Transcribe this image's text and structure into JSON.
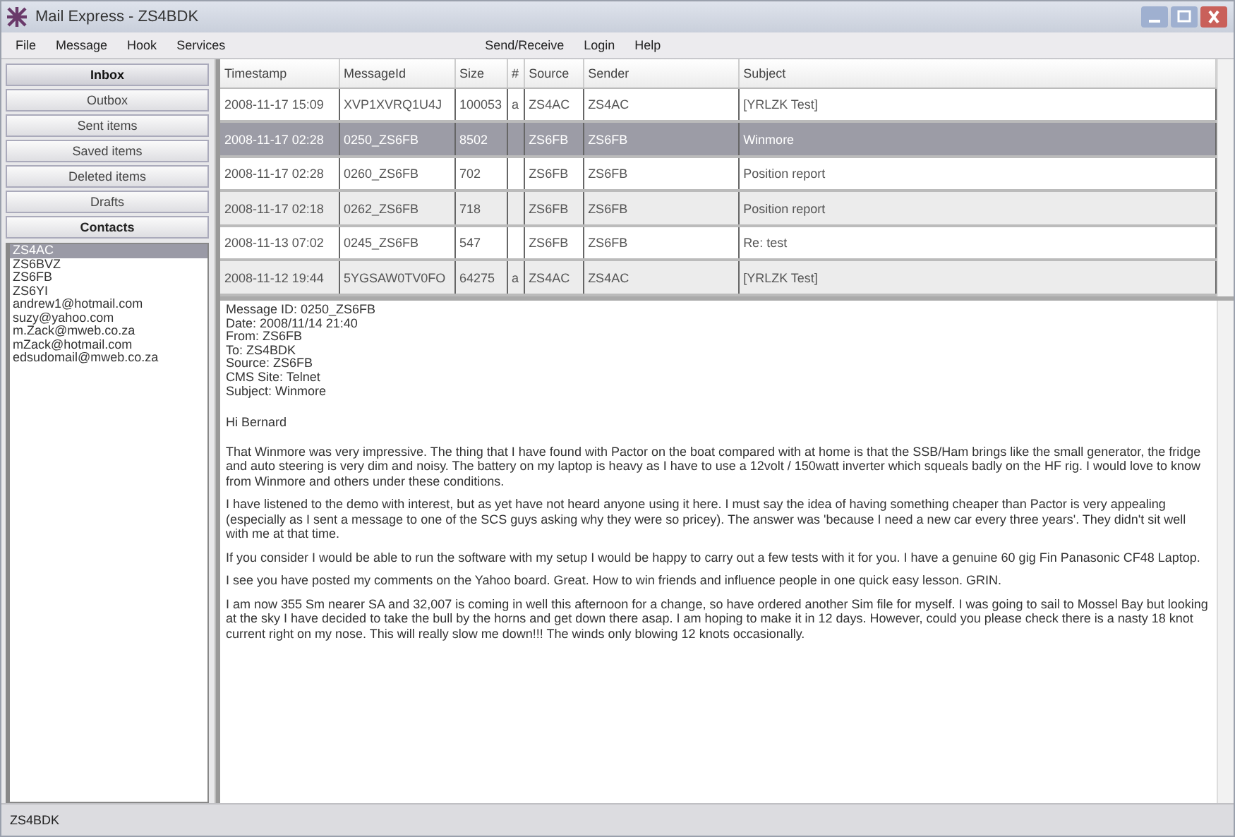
{
  "window": {
    "title": "Mail Express - ZS4BDK"
  },
  "menu": [
    "File",
    "Message",
    "Hook",
    "Services",
    "Send/Receive",
    "Login",
    "Help"
  ],
  "folders": [
    {
      "label": "Inbox",
      "selected": true
    },
    {
      "label": "Outbox",
      "selected": false
    },
    {
      "label": "Sent items",
      "selected": false
    },
    {
      "label": "Saved items",
      "selected": false
    },
    {
      "label": "Deleted items",
      "selected": false
    },
    {
      "label": "Drafts",
      "selected": false
    }
  ],
  "contacts": {
    "label": "Contacts",
    "items": [
      {
        "name": "ZS4AC",
        "selected": true
      },
      {
        "name": "ZS6BVZ",
        "selected": false
      },
      {
        "name": "ZS6FB",
        "selected": false
      },
      {
        "name": "ZS6YI",
        "selected": false
      },
      {
        "name": "andrew1@hotmail.com",
        "selected": false
      },
      {
        "name": "suzy@yahoo.com",
        "selected": false
      },
      {
        "name": "m.Zack@mweb.co.za",
        "selected": false
      },
      {
        "name": "mZack@hotmail.com",
        "selected": false
      },
      {
        "name": "edsudomail@mweb.co.za",
        "selected": false
      }
    ]
  },
  "table": {
    "columns": [
      "Timestamp",
      "MessageId",
      "Size",
      "#",
      "Source",
      "Sender",
      "Subject"
    ],
    "rows": [
      {
        "cells": [
          "2008-11-17 15:09",
          "XVP1XVRQ1U4J",
          "100053",
          "a",
          "ZS4AC",
          "ZS4AC",
          "[YRLZK Test]"
        ],
        "selected": false
      },
      {
        "cells": [
          "2008-11-17 02:28",
          "0250_ZS6FB",
          "8502",
          "",
          "ZS6FB",
          "ZS6FB",
          "Winmore"
        ],
        "selected": true
      },
      {
        "cells": [
          "2008-11-17 02:28",
          "0260_ZS6FB",
          "702",
          "",
          "ZS6FB",
          "ZS6FB",
          "Position report"
        ],
        "selected": false
      },
      {
        "cells": [
          "2008-11-17 02:18",
          "0262_ZS6FB",
          "718",
          "",
          "ZS6FB",
          "ZS6FB",
          "Position report"
        ],
        "selected": false
      },
      {
        "cells": [
          "2008-11-13 07:02",
          "0245_ZS6FB",
          "547",
          "",
          "ZS6FB",
          "ZS6FB",
          "Re: test"
        ],
        "selected": false
      },
      {
        "cells": [
          "2008-11-12 19:44",
          "5YGSAW0TV0FO",
          "64275",
          "a",
          "ZS4AC",
          "ZS4AC",
          "[YRLZK Test]"
        ],
        "selected": false
      }
    ]
  },
  "message": {
    "header": [
      "Message ID: 0250_ZS6FB",
      "Date: 2008/11/14 21:40",
      "From: ZS6FB",
      "To: ZS4BDK",
      "Source: ZS6FB",
      "CMS Site: Telnet",
      "Subject: Winmore"
    ],
    "greeting": "Hi Bernard",
    "paragraphs": [
      "That Winmore was very impressive. The thing that I have found with Pactor on the boat compared with at home is that the SSB/Ham brings like the small generator, the fridge and auto steering is very dim and noisy. The battery on my laptop is heavy as I have to use a 12volt / 150watt inverter which squeals badly on the HF rig. I would love to know from Winmore and others under these conditions.",
      "I have listened to the demo with interest, but as yet have not heard anyone using it here. I must say the idea of having something cheaper than Pactor is very appealing (especially as I sent a message to one of the SCS guys asking why they were so pricey). The answer was 'because I need a new car every three years'. They didn't sit well with me at that time.",
      "If you consider I would be able to run the software with my setup I would be happy to carry out a few tests with it for you. I have a genuine 60 gig Fin Panasonic CF48 Laptop.",
      "I see you have posted my comments on the Yahoo board. Great. How to win friends and influence people in one quick easy lesson. GRIN.",
      "I am now 355 Sm nearer SA and 32,007 is coming in well this afternoon for a change, so have ordered another Sim file for myself. I was going to sail to Mossel Bay but looking at the sky I have decided to take the bull by the horns and get down there asap. I am hoping to make it in 12 days. However, could you please check there is a nasty 18 knot current right on my nose. This will really slow me down!!! The winds only blowing 12 knots occasionally."
    ]
  },
  "status": "ZS4BDK"
}
